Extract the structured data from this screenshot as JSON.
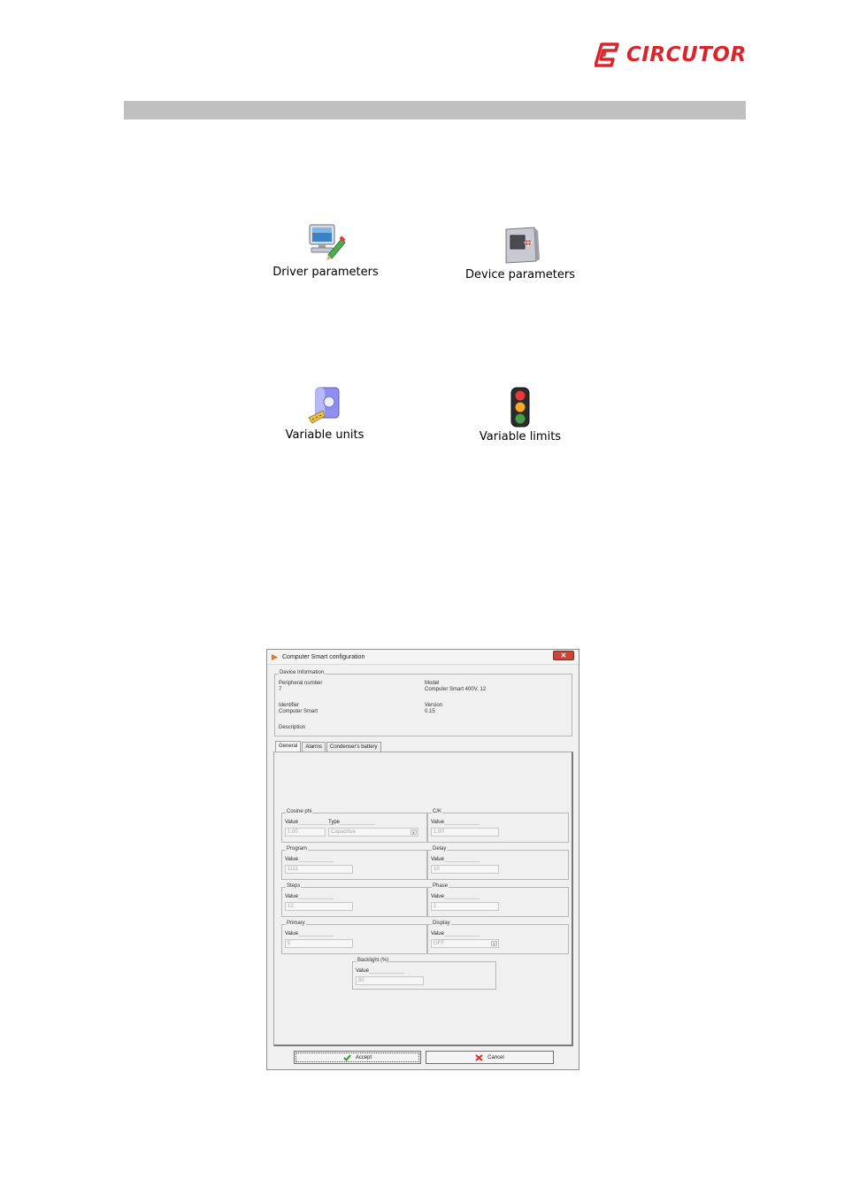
{
  "brand": {
    "name": "CIRCUTOR",
    "color": "#d9262d"
  },
  "menu": {
    "items": [
      {
        "label": "Driver parameters",
        "icon": "monitor-pencil-icon"
      },
      {
        "label": "Device parameters",
        "icon": "device-panel-icon"
      },
      {
        "label": "Variable units",
        "icon": "unit-ruler-icon"
      },
      {
        "label": "Variable limits",
        "icon": "traffic-light-icon"
      }
    ]
  },
  "dialog": {
    "title": "Computer Smart configuration",
    "device_info": {
      "title": "Device Information",
      "peripheral_label": "Peripheral number",
      "peripheral_value": "7",
      "model_label": "Model",
      "model_value": "Computer Smart 400V, 12",
      "identifier_label": "Identifier",
      "identifier_value": "Computer Smart",
      "version_label": "Version",
      "version_value": "0.15",
      "description_label": "Description"
    },
    "tabs": [
      "General",
      "Alarms",
      "Condenser's battery"
    ],
    "groups": {
      "cosine_phi": {
        "title": "Cosine phi",
        "value_label": "Value",
        "value": "1.00",
        "type_label": "Type",
        "type_value": "Capacitive"
      },
      "ck": {
        "title": "C/K",
        "value_label": "Value",
        "value": "1.00"
      },
      "program": {
        "title": "Program",
        "value_label": "Value",
        "value": "1111"
      },
      "delay": {
        "title": "Delay",
        "value_label": "Value",
        "value": "10"
      },
      "steps": {
        "title": "Steps",
        "value_label": "Value",
        "value": "12"
      },
      "phase": {
        "title": "Phase",
        "value_label": "Value",
        "value": "1"
      },
      "primary": {
        "title": "Primary",
        "value_label": "Value",
        "value": "5"
      },
      "display": {
        "title": "Display",
        "value_label": "Value",
        "value": "OFF"
      },
      "backlight": {
        "title": "Backlight (%)",
        "value_label": "Value",
        "value": "80"
      }
    },
    "accept_label": "Accept",
    "cancel_label": "Cancel"
  }
}
